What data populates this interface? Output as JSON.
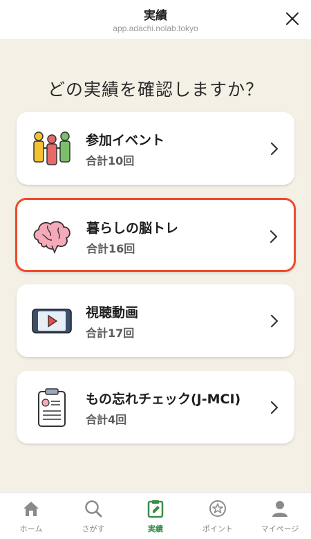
{
  "header": {
    "title": "実績",
    "url": "app.adachi.nolab.tokyo"
  },
  "main": {
    "heading": "どの実績を確認しますか？",
    "cards": [
      {
        "name": "参加イベント",
        "count": "合計10回",
        "icon": "people-icon"
      },
      {
        "name": "暮らしの脳トレ",
        "count": "合計16回",
        "icon": "brain-icon"
      },
      {
        "name": "視聴動画",
        "count": "合計17回",
        "icon": "video-icon"
      },
      {
        "name": "もの忘れチェック(J-MCI)",
        "count": "合計4回",
        "icon": "clipboard-icon"
      }
    ]
  },
  "tabbar": {
    "tabs": [
      {
        "label": "ホーム",
        "icon": "home-icon"
      },
      {
        "label": "さがす",
        "icon": "search-icon"
      },
      {
        "label": "実績",
        "icon": "achievement-icon"
      },
      {
        "label": "ポイント",
        "icon": "point-icon"
      },
      {
        "label": "マイページ",
        "icon": "user-icon"
      }
    ]
  },
  "colors": {
    "accent": "#3a8a4a",
    "selected_border": "#ee4a2b",
    "background": "#f4f0e6"
  }
}
